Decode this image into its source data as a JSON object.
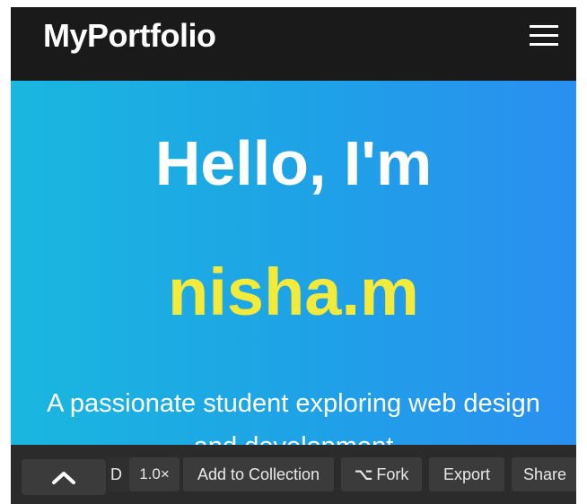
{
  "header": {
    "brand": "MyPortfolio",
    "menu_icon": "hamburger-menu-icon"
  },
  "hero": {
    "greeting": "Hello, I'm",
    "name": "nisha.m",
    "tagline_line1": "A passionate student exploring web design",
    "tagline_line2": "and development",
    "colors": {
      "gradient_start": "#1ab7df",
      "gradient_end": "#2a8ff0",
      "name_color": "#f3ea3a"
    }
  },
  "toolbar": {
    "collapse_icon": "chevron-up-icon",
    "truncated_label": "D",
    "zoom": "1.0×",
    "add_to_collection": "Add to Collection",
    "fork_icon": "fork-icon",
    "fork": "Fork",
    "export": "Export",
    "share": "Share"
  }
}
